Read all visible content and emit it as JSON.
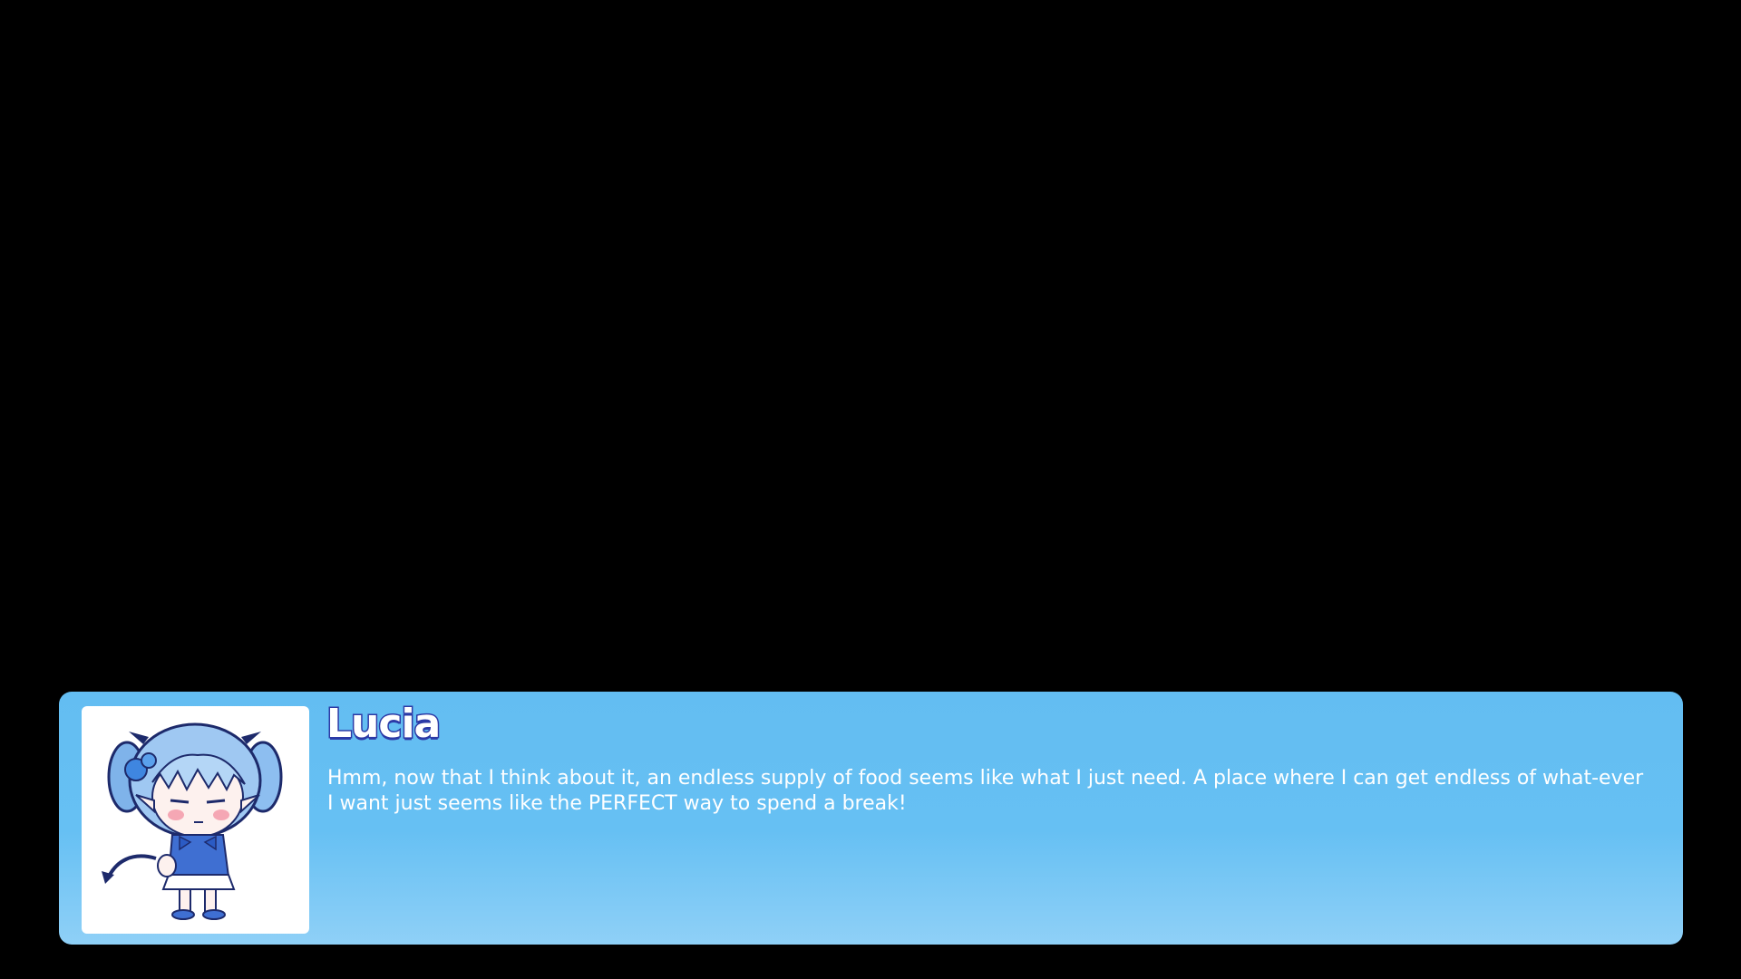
{
  "scene": {
    "background_color": "#000000"
  },
  "dialogue": {
    "speaker": "Lucia",
    "text": "Hmm, now that I think about it, an endless supply of food seems like what I just need. A place where I can get endless of what-ever I want just seems like the PERFECT way to spend a break!",
    "box_color": "#63bdf2",
    "name_outline_color": "#2c3aa6",
    "portrait_icon": "lucia-chibi-portrait-icon"
  }
}
